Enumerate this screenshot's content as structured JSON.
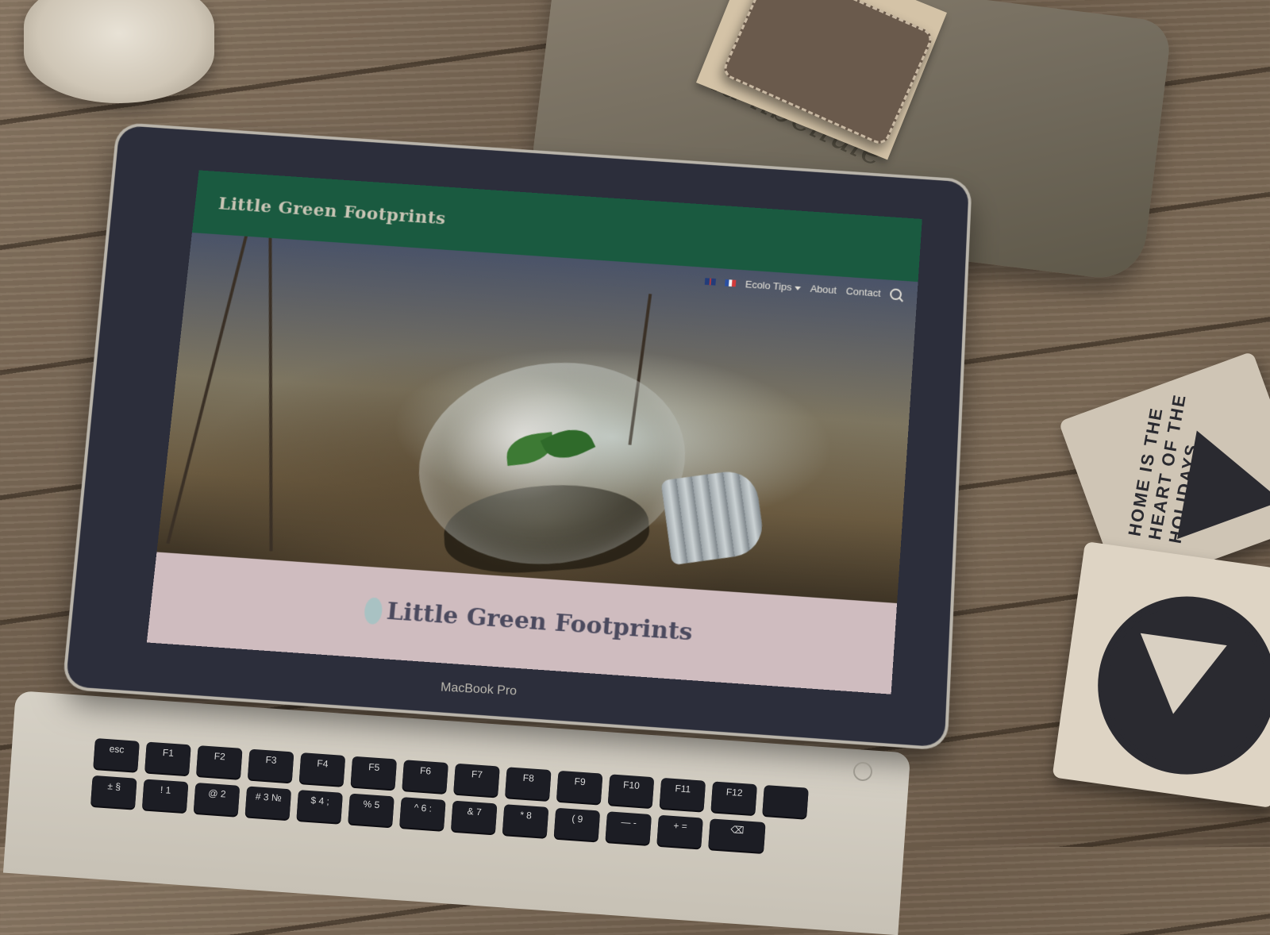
{
  "site": {
    "brand": "Little Green Footprints",
    "nav": {
      "lang_en_icon": "uk-flag-icon",
      "lang_fr_icon": "fr-flag-icon",
      "ecolo_tips": "Ecolo Tips",
      "about": "About",
      "contact": "Contact",
      "search_icon": "search-icon"
    },
    "hero_image_subject": "lightbulb-with-sprout-photo",
    "footer_brand": "Little Green Footprints"
  },
  "device": {
    "model_label": "MacBook Pro"
  },
  "keyboard": {
    "row1": [
      "esc",
      "F1",
      "F2",
      "F3",
      "F4",
      "F5",
      "F6",
      "F7",
      "F8",
      "F9",
      "F10",
      "F11",
      "F12",
      ""
    ],
    "row2": [
      "± §",
      "! 1",
      "@ 2",
      "# 3 №",
      "$ 4 ;",
      "% 5",
      "^ 6 :",
      "& 7",
      "* 8",
      "( 9",
      "— -",
      "+ =",
      "⌫"
    ]
  },
  "props": {
    "pouch_text": "la libellule",
    "jar_text": "",
    "tile_text": "HOME IS THE HEART OF THE HOLIDAYS"
  },
  "colors": {
    "header_green": "#1a5a40",
    "footer_pink": "#cfbcbf",
    "logo_dark": "#4b4a5e",
    "laptop_bezel": "#2c2e3b"
  }
}
